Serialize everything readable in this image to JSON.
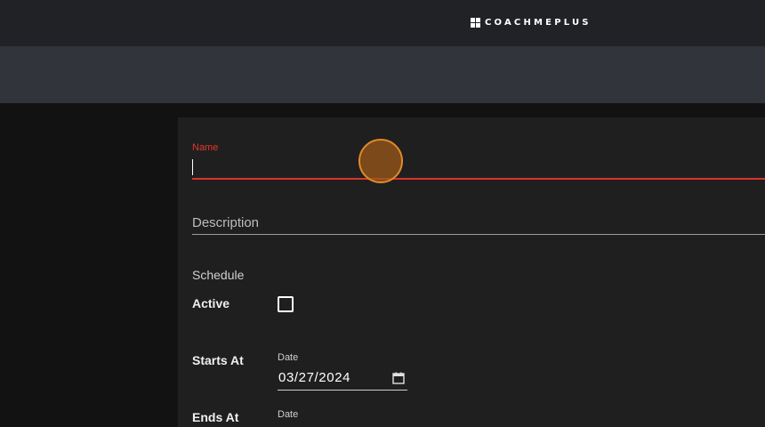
{
  "header": {
    "brand": "COACHMEPLUS",
    "brand_icon": "grid-logo-icon"
  },
  "form": {
    "name": {
      "label": "Name",
      "value": ""
    },
    "description": {
      "placeholder": "Description",
      "value": ""
    },
    "section_title": "Schedule",
    "active": {
      "label": "Active",
      "checked": false
    },
    "starts_at": {
      "label": "Starts At",
      "date_caption": "Date",
      "date_value": "03/27/2024",
      "icon": "calendar-icon"
    },
    "ends_at": {
      "label": "Ends At",
      "date_caption": "Date"
    }
  },
  "colors": {
    "accent_error": "#d9342b",
    "touch_indicator": "#e08a2a",
    "topbar": "#212226",
    "subbar": "#31343a"
  }
}
